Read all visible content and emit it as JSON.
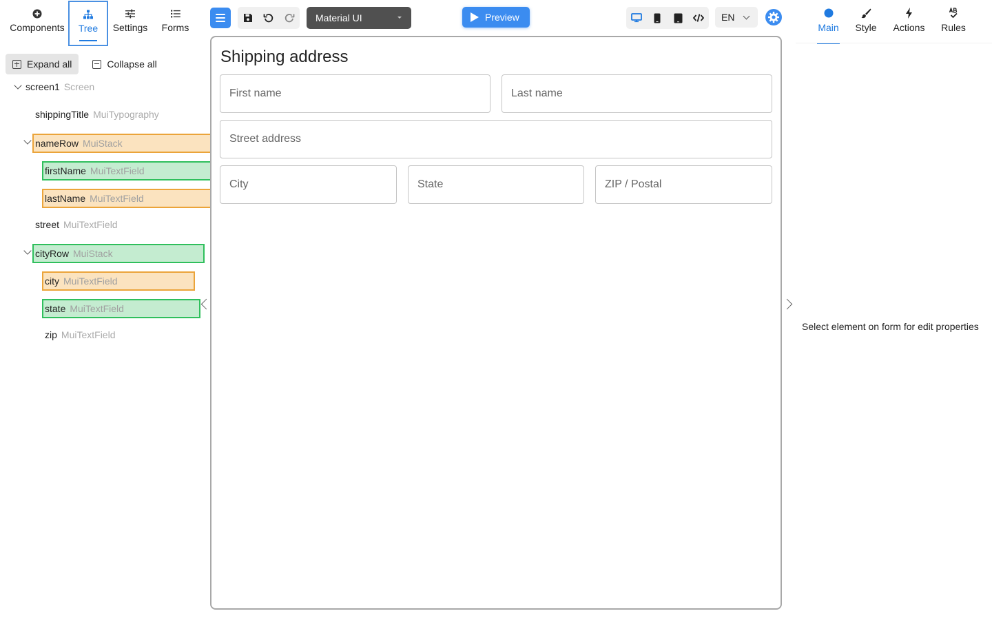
{
  "left_tabs": [
    {
      "label": "Components",
      "icon": "plus-circle-icon"
    },
    {
      "label": "Tree",
      "icon": "hierarchy-icon",
      "active": true
    },
    {
      "label": "Settings",
      "icon": "sliders-icon"
    },
    {
      "label": "Forms",
      "icon": "list-icon"
    }
  ],
  "tree_actions": {
    "expand_all": "Expand all",
    "collapse_all": "Collapse all"
  },
  "tree": [
    {
      "name": "screen1",
      "type": "Screen"
    },
    {
      "name": "shippingTitle",
      "type": "MuiTypography"
    },
    {
      "name": "nameRow",
      "type": "MuiStack"
    },
    {
      "name": "firstName",
      "type": "MuiTextField"
    },
    {
      "name": "lastName",
      "type": "MuiTextField"
    },
    {
      "name": "street",
      "type": "MuiTextField"
    },
    {
      "name": "cityRow",
      "type": "MuiStack"
    },
    {
      "name": "city",
      "type": "MuiTextField"
    },
    {
      "name": "state",
      "type": "MuiTextField"
    },
    {
      "name": "zip",
      "type": "MuiTextField"
    }
  ],
  "toolbar": {
    "theme": "Material UI",
    "preview": "Preview",
    "language": "EN"
  },
  "form": {
    "title": "Shipping address",
    "fields": {
      "first_name": "First name",
      "last_name": "Last name",
      "street": "Street address",
      "city": "City",
      "state": "State",
      "zip": "ZIP / Postal"
    }
  },
  "right_tabs": [
    {
      "label": "Main",
      "icon": "dot-icon",
      "active": true
    },
    {
      "label": "Style",
      "icon": "brush-icon"
    },
    {
      "label": "Actions",
      "icon": "lightning-icon"
    },
    {
      "label": "Rules",
      "icon": "rules-icon"
    }
  ],
  "right_panel": {
    "message": "Select element on form for edit properties"
  },
  "colors": {
    "accent": "#3b8cf0",
    "highlight_orange": "#eba43a",
    "highlight_green": "#2fbf5c"
  }
}
